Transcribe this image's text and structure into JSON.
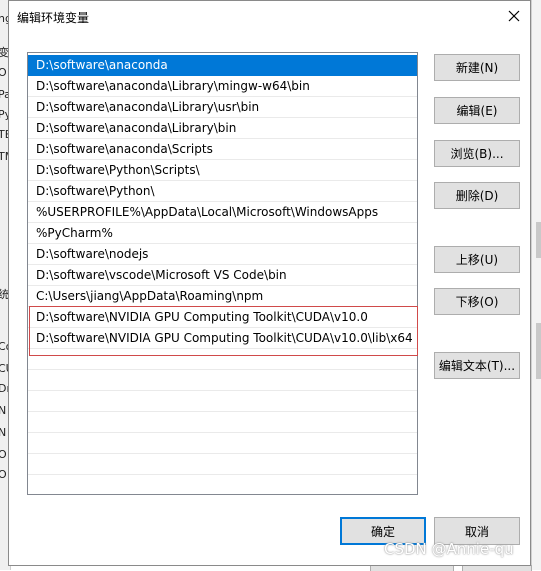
{
  "background": {
    "left_fragments": [
      "ng",
      "变",
      "O",
      "Pa",
      "Py",
      "TE",
      "TM",
      "统",
      "Co",
      "CU",
      "Dr",
      "N",
      "N",
      "O",
      "O"
    ]
  },
  "dialog": {
    "title": "编辑环境变量",
    "paths": [
      "D:\\software\\anaconda",
      "D:\\software\\anaconda\\Library\\mingw-w64\\bin",
      "D:\\software\\anaconda\\Library\\usr\\bin",
      "D:\\software\\anaconda\\Library\\bin",
      "D:\\software\\anaconda\\Scripts",
      "D:\\software\\Python\\Scripts\\",
      "D:\\software\\Python\\",
      "%USERPROFILE%\\AppData\\Local\\Microsoft\\WindowsApps",
      "%PyCharm%",
      "D:\\software\\nodejs",
      "D:\\software\\vscode\\Microsoft VS Code\\bin",
      "C:\\Users\\jiang\\AppData\\Roaming\\npm",
      "D:\\software\\NVIDIA GPU Computing Toolkit\\CUDA\\v10.0",
      "D:\\software\\NVIDIA GPU Computing Toolkit\\CUDA\\v10.0\\lib\\x64"
    ],
    "buttons": {
      "new": "新建(N)",
      "edit": "编辑(E)",
      "browse": "浏览(B)...",
      "delete": "删除(D)",
      "move_up": "上移(U)",
      "move_down": "下移(O)",
      "edit_text": "编辑文本(T)...",
      "ok": "确定",
      "cancel": "取消"
    }
  },
  "watermark": "CSDN @Annie-qu",
  "colors": {
    "selection": "#0078d7",
    "highlight_box": "#d04a4a"
  }
}
